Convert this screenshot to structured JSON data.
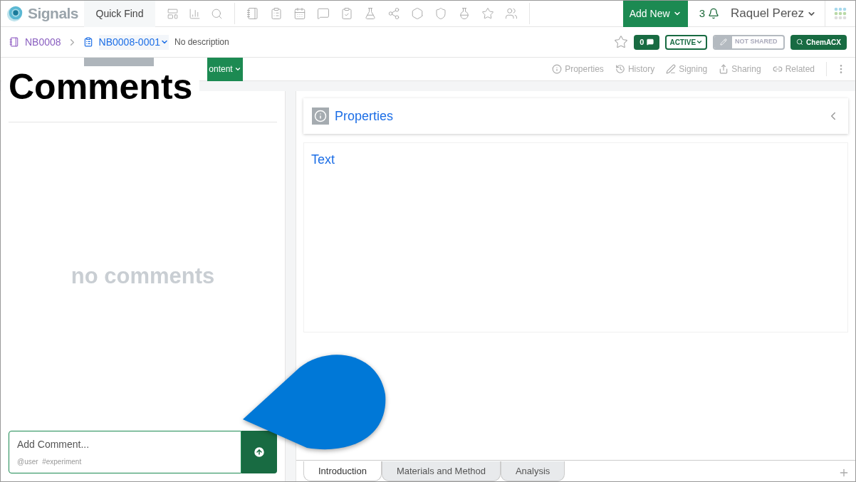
{
  "app": {
    "name": "Signals",
    "quick_find": "Quick Find",
    "add_new": "Add New",
    "notifications": "3",
    "user": "Raquel Perez"
  },
  "breadcrumb": {
    "notebook": "NB0008",
    "experiment": "NB0008-0001",
    "description": "No description"
  },
  "badges": {
    "comments": "0",
    "status": "ACTIVE",
    "sharing": "NOT SHARED",
    "search": "ChemACX"
  },
  "toolbar": {
    "content_button": "ontent",
    "links": [
      "Properties",
      "History",
      "Signing",
      "Sharing",
      "Related"
    ]
  },
  "overlay_title": "Comments",
  "comments": {
    "empty": "no comments",
    "placeholder": "Add Comment...",
    "hints": "@user  #experiment"
  },
  "properties": {
    "title": "Properties",
    "section": "Text"
  },
  "sheet_tabs": [
    {
      "label": "Introduction",
      "selected": true
    },
    {
      "label": "Materials and Method",
      "selected": false
    },
    {
      "label": "Analysis",
      "selected": false
    }
  ]
}
